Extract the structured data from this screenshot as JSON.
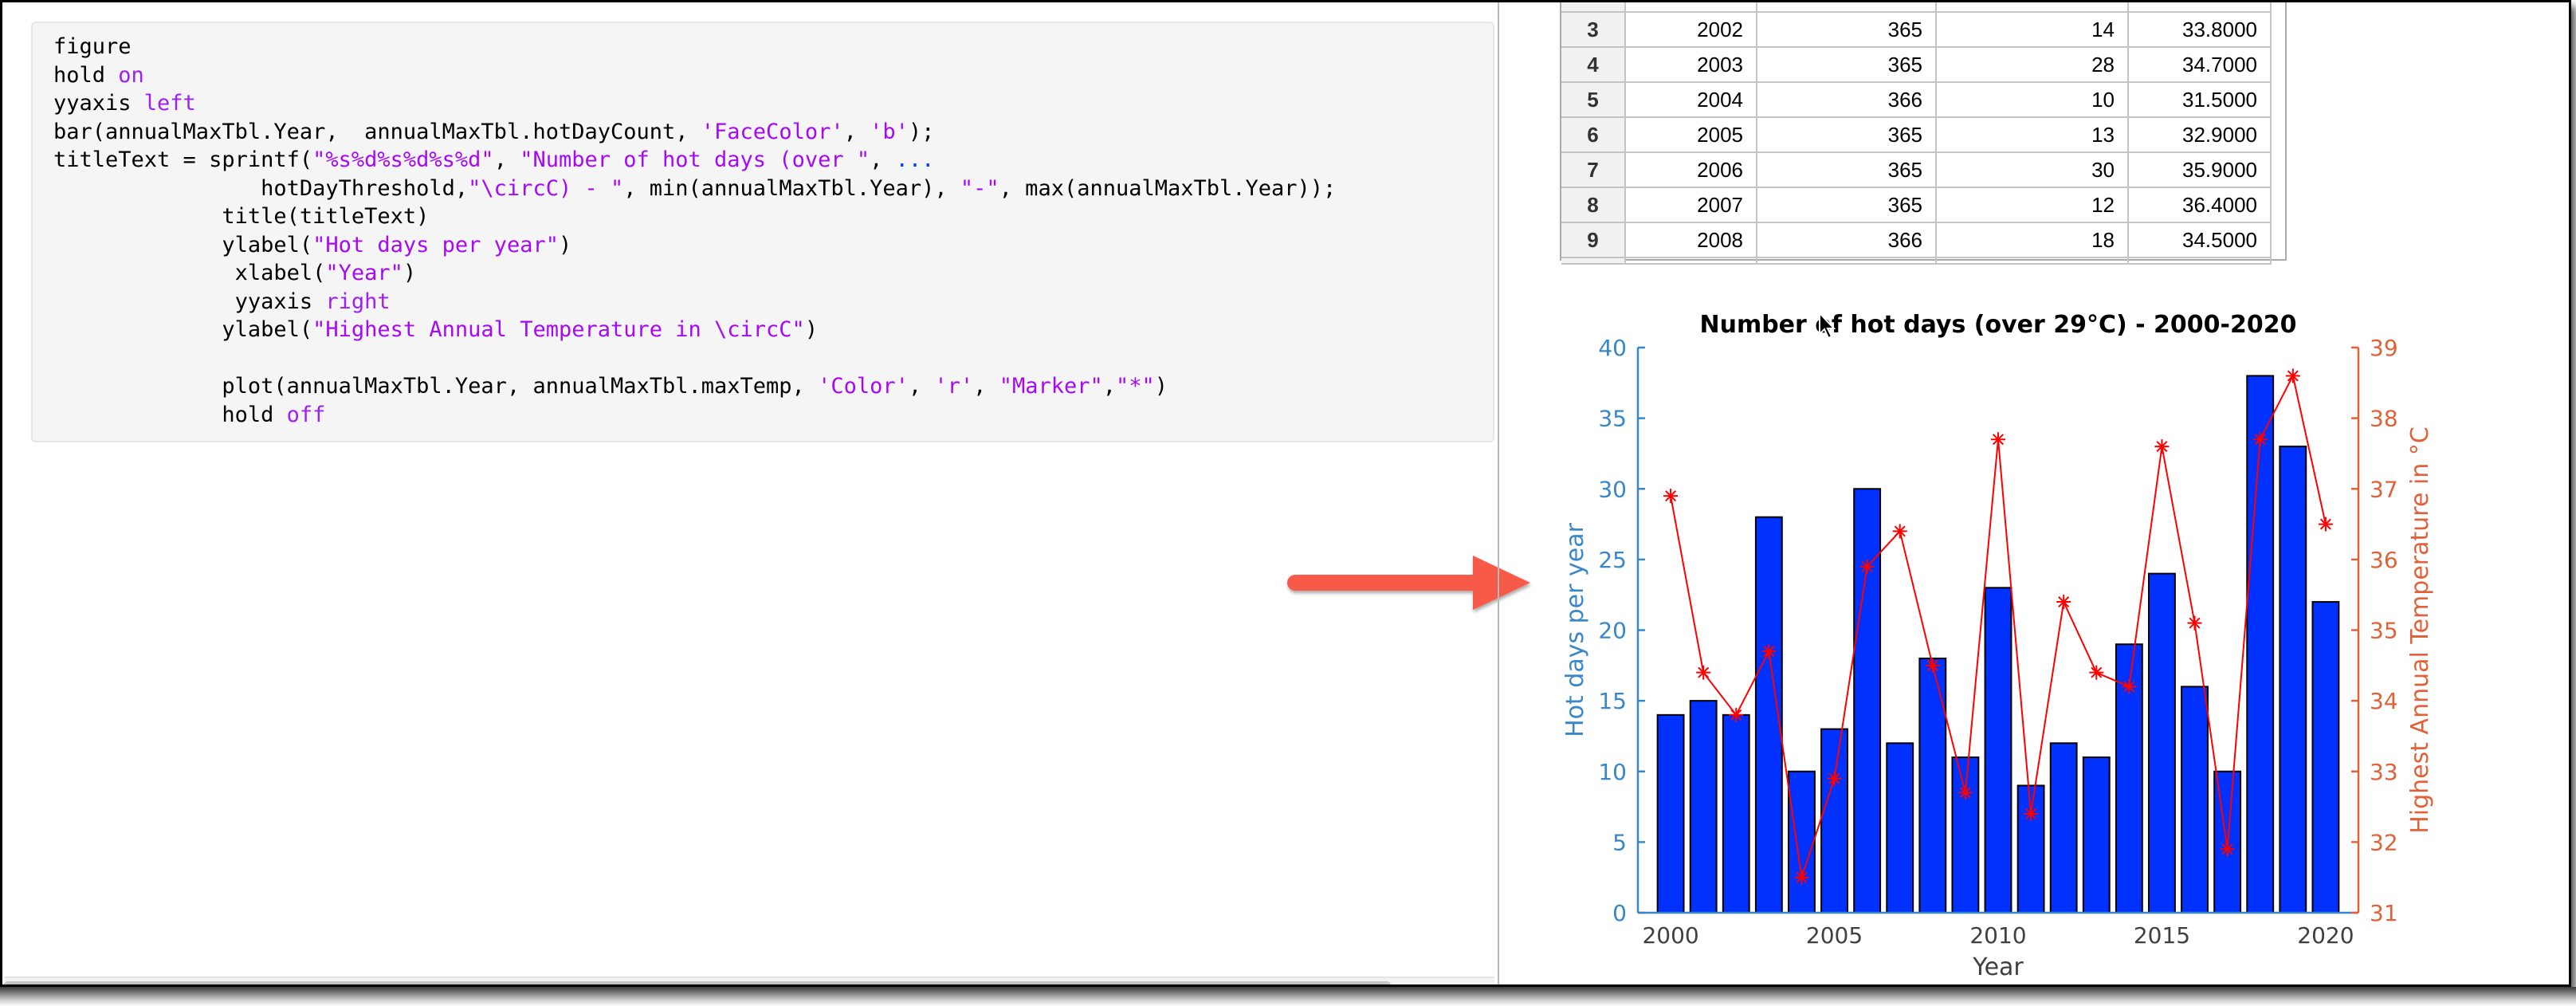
{
  "code": {
    "lines": [
      [
        {
          "t": "figure",
          "c": ""
        }
      ],
      [
        {
          "t": "hold ",
          "c": ""
        },
        {
          "t": "on",
          "c": "kw"
        }
      ],
      [
        {
          "t": "yyaxis ",
          "c": ""
        },
        {
          "t": "left",
          "c": "kw"
        }
      ],
      [
        {
          "t": "bar(annualMaxTbl.Year,  annualMaxTbl.hotDayCount, ",
          "c": ""
        },
        {
          "t": "'FaceColor'",
          "c": "str"
        },
        {
          "t": ", ",
          "c": ""
        },
        {
          "t": "'b'",
          "c": "str"
        },
        {
          "t": ");",
          "c": ""
        }
      ],
      [
        {
          "t": "titleText = sprintf(",
          "c": ""
        },
        {
          "t": "\"%s%d%s%d%s%d\"",
          "c": "str"
        },
        {
          "t": ", ",
          "c": ""
        },
        {
          "t": "\"Number of hot days (over \"",
          "c": "str"
        },
        {
          "t": ", ",
          "c": ""
        },
        {
          "t": "...",
          "c": "cont"
        }
      ],
      [
        {
          "t": "                hotDayThreshold,",
          "c": ""
        },
        {
          "t": "\"\\circC) - \"",
          "c": "str"
        },
        {
          "t": ", min(annualMaxTbl.Year), ",
          "c": ""
        },
        {
          "t": "\"-\"",
          "c": "str"
        },
        {
          "t": ", max(annualMaxTbl.Year));",
          "c": ""
        }
      ],
      [
        {
          "t": "             title(titleText)",
          "c": ""
        }
      ],
      [
        {
          "t": "             ylabel(",
          "c": ""
        },
        {
          "t": "\"Hot days per year\"",
          "c": "str"
        },
        {
          "t": ")",
          "c": ""
        }
      ],
      [
        {
          "t": "              xlabel(",
          "c": ""
        },
        {
          "t": "\"Year\"",
          "c": "str"
        },
        {
          "t": ")",
          "c": ""
        }
      ],
      [
        {
          "t": "              yyaxis ",
          "c": ""
        },
        {
          "t": "right",
          "c": "kw"
        }
      ],
      [
        {
          "t": "             ylabel(",
          "c": ""
        },
        {
          "t": "\"Highest Annual Temperature in \\circC\"",
          "c": "str"
        },
        {
          "t": ")",
          "c": ""
        }
      ],
      [
        {
          "t": "",
          "c": ""
        }
      ],
      [
        {
          "t": "             plot(annualMaxTbl.Year, annualMaxTbl.maxTemp, ",
          "c": ""
        },
        {
          "t": "'Color'",
          "c": "str"
        },
        {
          "t": ", ",
          "c": ""
        },
        {
          "t": "'r'",
          "c": "str"
        },
        {
          "t": ", ",
          "c": ""
        },
        {
          "t": "\"Marker\"",
          "c": "str"
        },
        {
          "t": ",",
          "c": ""
        },
        {
          "t": "\"*\"",
          "c": "str"
        },
        {
          "t": ")",
          "c": ""
        }
      ],
      [
        {
          "t": "             hold ",
          "c": ""
        },
        {
          "t": "off",
          "c": "kw"
        }
      ]
    ]
  },
  "table": {
    "rows": [
      [
        "3",
        "2002",
        "365",
        "14",
        "33.8000"
      ],
      [
        "4",
        "2003",
        "365",
        "28",
        "34.7000"
      ],
      [
        "5",
        "2004",
        "366",
        "10",
        "31.5000"
      ],
      [
        "6",
        "2005",
        "365",
        "13",
        "32.9000"
      ],
      [
        "7",
        "2006",
        "365",
        "30",
        "35.9000"
      ],
      [
        "8",
        "2007",
        "365",
        "12",
        "36.4000"
      ],
      [
        "9",
        "2008",
        "366",
        "18",
        "34.5000"
      ]
    ]
  },
  "icons": {
    "arrow": "annotation-arrow-right",
    "cursor": "mouse-pointer"
  },
  "colors": {
    "bar_fill": "#0031ff",
    "line": "#ff0000",
    "left_axis": "#3a87c8",
    "right_axis": "#e0623a",
    "arrow": "#f85a4a"
  },
  "chart_data": {
    "type": "bar",
    "title": "Number of hot days (over 29°C) - 2000-2020",
    "xlabel": "Year",
    "ylabel": "Hot days per year",
    "ylabel_right": "Highest Annual Temperature in °C",
    "x": [
      2000,
      2001,
      2002,
      2003,
      2004,
      2005,
      2006,
      2007,
      2008,
      2009,
      2010,
      2011,
      2012,
      2013,
      2014,
      2015,
      2016,
      2017,
      2018,
      2019,
      2020
    ],
    "xticks": [
      "2000",
      "2005",
      "2010",
      "2015",
      "2020"
    ],
    "xlim": [
      1999,
      2021
    ],
    "ylim": [
      0,
      40
    ],
    "yticks": [
      "0",
      "5",
      "10",
      "15",
      "20",
      "25",
      "30",
      "35",
      "40"
    ],
    "ylim_right": [
      31,
      39
    ],
    "yticks_right": [
      "31",
      "32",
      "33",
      "34",
      "35",
      "36",
      "37",
      "38",
      "39"
    ],
    "grid": false,
    "series": [
      {
        "name": "hotDayCount",
        "type": "bar",
        "axis": "left",
        "values": [
          14,
          15,
          14,
          28,
          10,
          13,
          30,
          12,
          18,
          11,
          23,
          9,
          12,
          11,
          19,
          24,
          16,
          10,
          38,
          33,
          22
        ]
      },
      {
        "name": "maxTemp",
        "type": "line",
        "axis": "right",
        "marker": "*",
        "values": [
          36.9,
          34.4,
          33.8,
          34.7,
          31.5,
          32.9,
          35.9,
          36.4,
          34.5,
          32.7,
          37.7,
          32.4,
          35.4,
          34.4,
          34.2,
          37.6,
          35.1,
          31.9,
          37.7,
          38.6,
          36.5
        ]
      }
    ]
  }
}
